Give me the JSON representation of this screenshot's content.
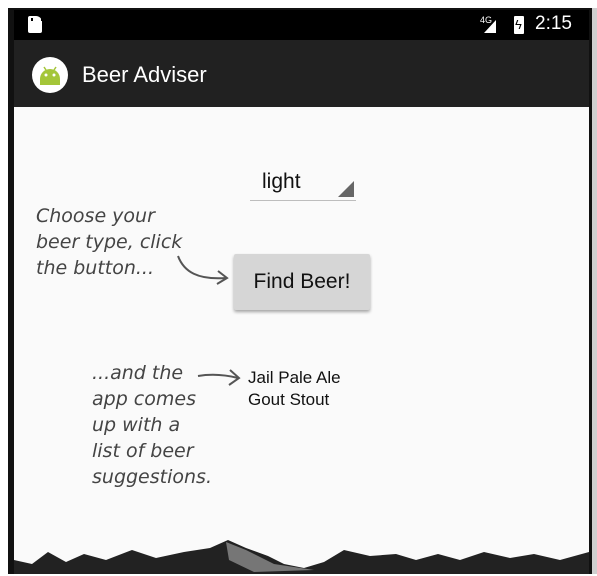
{
  "status_bar": {
    "network": "4G",
    "time": "2:15",
    "icons": [
      "sd-card-icon",
      "signal-icon",
      "battery-charging-icon"
    ]
  },
  "app_bar": {
    "title": "Beer Adviser",
    "icon": "android-icon"
  },
  "spinner": {
    "selected": "light",
    "icon": "dropdown-triangle-icon"
  },
  "button": {
    "label": "Find Beer!"
  },
  "results": {
    "lines": [
      "Jail Pale Ale",
      "Gout Stout"
    ]
  },
  "annotations": {
    "note1": "Choose your\nbeer type, click\nthe button...",
    "note2": "...and the\napp comes\nup with a\nlist of beer\nsuggestions."
  },
  "colors": {
    "app_bar": "#212121",
    "status_bar": "#000000",
    "background": "#fafafa",
    "android_green": "#a4c639"
  }
}
